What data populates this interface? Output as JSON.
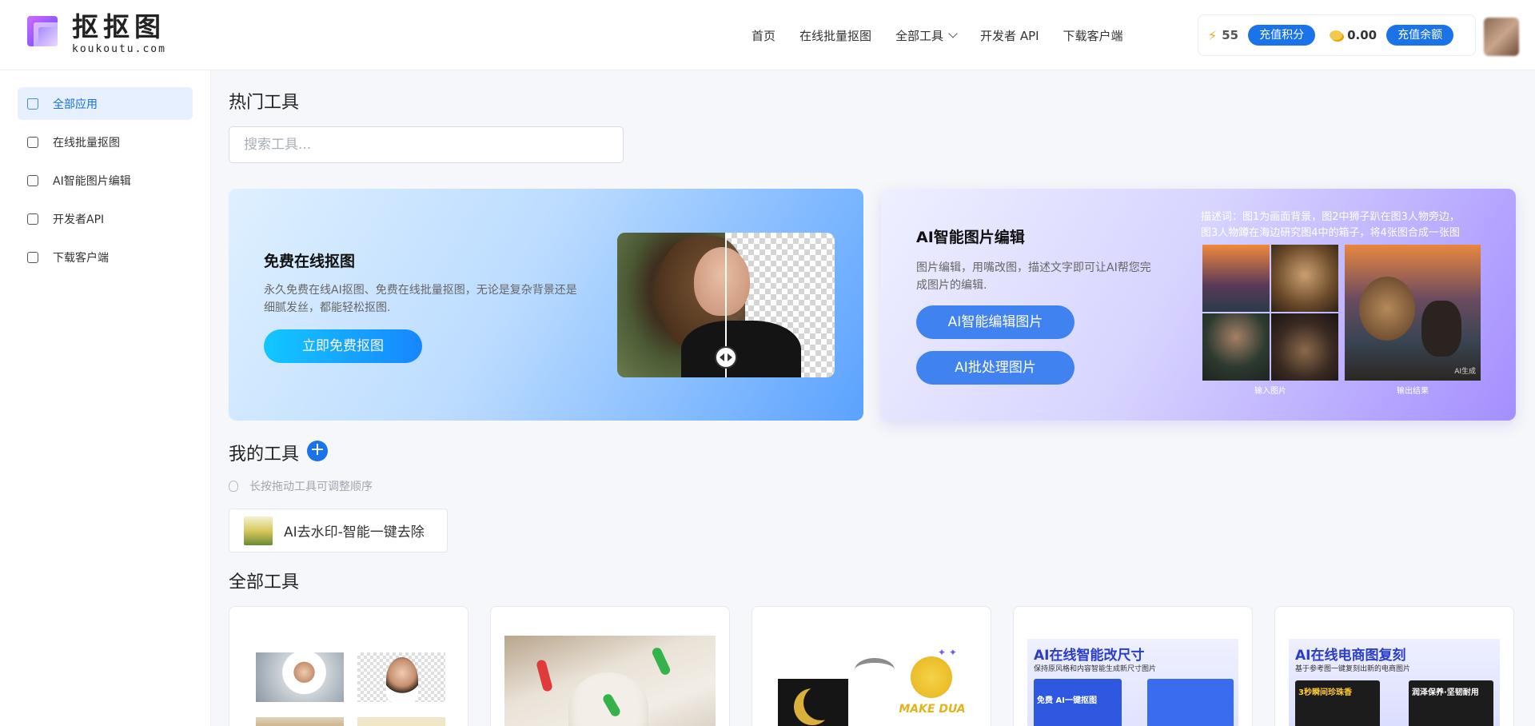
{
  "header": {
    "logo_cn": "抠抠图",
    "logo_en": "koukoutu.com",
    "nav": [
      {
        "label": "首页"
      },
      {
        "label": "在线批量抠图"
      },
      {
        "label": "全部工具",
        "dropdown": true
      },
      {
        "label": "开发者 API"
      },
      {
        "label": "下载客户端"
      }
    ],
    "account": {
      "points": "55",
      "points_btn": "充值积分",
      "balance": "0.00",
      "balance_btn": "充值余额"
    }
  },
  "sidebar": {
    "items": [
      {
        "label": "全部应用",
        "icon": "home-icon",
        "active": true
      },
      {
        "label": "在线批量抠图",
        "icon": "portrait-icon"
      },
      {
        "label": "AI智能图片编辑",
        "icon": "edit-icon"
      },
      {
        "label": "开发者API",
        "icon": "api-icon"
      },
      {
        "label": "下载客户端",
        "icon": "download-icon"
      }
    ]
  },
  "main": {
    "hot_title": "热门工具",
    "search_placeholder": "搜索工具...",
    "banner1": {
      "title": "免费在线抠图",
      "desc": "永久免费在线AI抠图、免费在线批量抠图，无论是复杂背景还是细腻发丝，都能轻松抠图.",
      "button": "立即免费抠图"
    },
    "banner2": {
      "title": "AI智能图片编辑",
      "desc": "图片编辑，用嘴改图，描述文字即可让AI帮您完成图片的编辑.",
      "button1": "AI智能编辑图片",
      "button2": "AI批处理图片",
      "caption_line1": "描述词：图1为画面背景，图2中狮子趴在图3人物旁边，",
      "caption_line2": "图3人物蹲在海边研究图4中的箱子，将4张图合成一张图",
      "label_input": "输入图片",
      "label_output": "输出结果",
      "watermark": "AI生成"
    },
    "my_tools_title": "我的工具",
    "hint": "长按拖动工具可调整顺序",
    "my_tools": [
      {
        "label": "AI去水印-智能一键去除"
      }
    ],
    "all_tools_title": "全部工具",
    "tool_cards": [
      {
        "text": ""
      },
      {
        "text": ""
      },
      {
        "text": "MAKE DUA"
      },
      {
        "text": "AI在线智能改尺寸",
        "sub": "保持原风格和内容智能生成新尺寸图片",
        "line2": "免费 AI一键抠图"
      },
      {
        "text": "AI在线电商图复刻",
        "sub": "基于参考图一键复刻出新的电商图片",
        "line2": "3秒瞬间珍珠香",
        "line3": "润泽保养·坚韧耐用"
      }
    ]
  },
  "colors": {
    "primary": "#1a73e8",
    "active_bg": "#e6f0ff"
  }
}
